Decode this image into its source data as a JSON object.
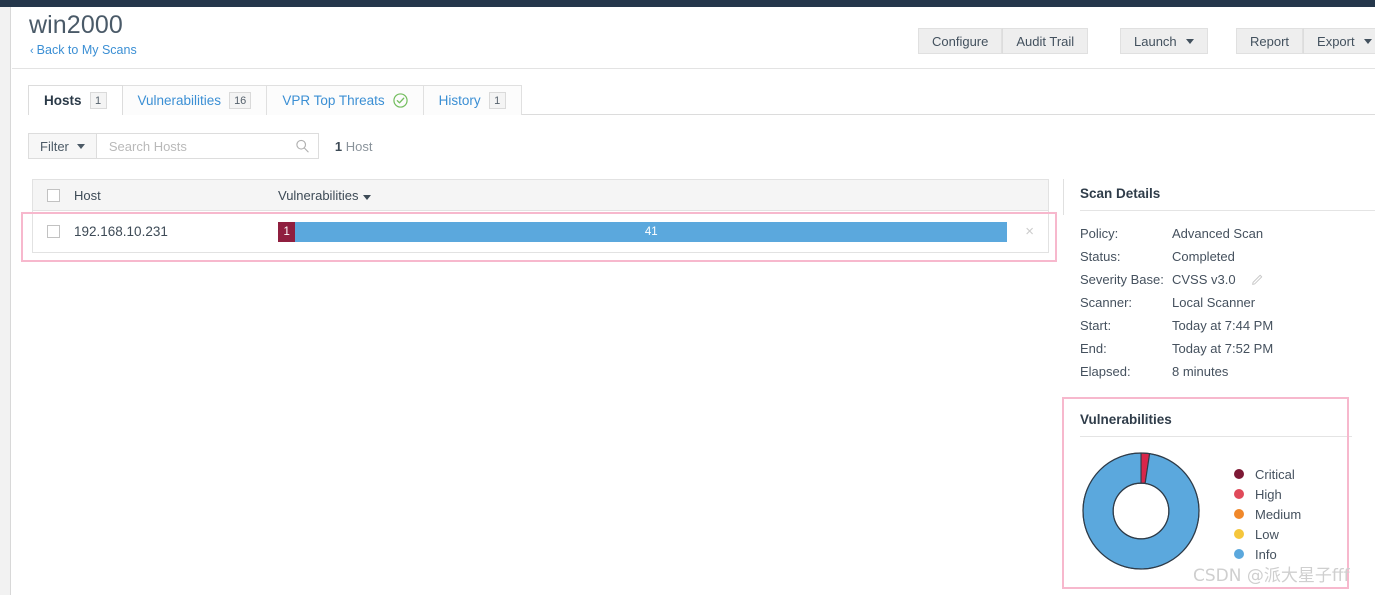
{
  "header": {
    "scan_title": "win2000",
    "back_link": "Back to My Scans",
    "back_chevron": "‹",
    "buttons_group_a": [
      {
        "label": "Configure",
        "caret": false
      },
      {
        "label": "Audit Trail",
        "caret": false
      }
    ],
    "buttons_group_b": [
      {
        "label": "Launch",
        "caret": true
      }
    ],
    "buttons_group_c": [
      {
        "label": "Report",
        "caret": false
      },
      {
        "label": "Export",
        "caret": true
      }
    ]
  },
  "tabs": [
    {
      "label": "Hosts",
      "badge": "1",
      "active": true,
      "icon": ""
    },
    {
      "label": "Vulnerabilities",
      "badge": "16",
      "active": false,
      "icon": ""
    },
    {
      "label": "VPR Top Threats",
      "badge": "",
      "active": false,
      "icon": "check-circle-icon"
    },
    {
      "label": "History",
      "badge": "1",
      "active": false,
      "icon": ""
    }
  ],
  "filter_bar": {
    "filter_label": "Filter",
    "search_placeholder": "Search Hosts",
    "search_value": "",
    "search_icon": "search-icon",
    "count_number": "1",
    "count_label": "Host"
  },
  "hosts_table": {
    "columns": [
      "Host",
      "Vulnerabilities"
    ],
    "sort_column": "Vulnerabilities",
    "sort_direction": "desc",
    "rows": [
      {
        "host": "192.168.10.231",
        "remove_icon": "×",
        "segments": [
          {
            "severity": "Critical",
            "count": "1",
            "color": "#8f1f3f",
            "width_pct": 2.4
          },
          {
            "severity": "Info",
            "count": "41",
            "color": "#5ba8dd",
            "width_pct": 97.6
          }
        ]
      }
    ]
  },
  "scan_details": {
    "title": "Scan Details",
    "edit_icon": "pencil-icon",
    "rows": [
      {
        "label": "Policy:",
        "value": "Advanced Scan",
        "edit": false
      },
      {
        "label": "Status:",
        "value": "Completed",
        "edit": false
      },
      {
        "label": "Severity Base:",
        "value": "CVSS v3.0",
        "edit": true
      },
      {
        "label": "Scanner:",
        "value": "Local Scanner",
        "edit": false
      },
      {
        "label": "Start:",
        "value": "Today at 7:44 PM",
        "edit": false
      },
      {
        "label": "End:",
        "value": "Today at 7:52 PM",
        "edit": false
      },
      {
        "label": "Elapsed:",
        "value": "8 minutes",
        "edit": false
      }
    ]
  },
  "vulnerabilities_panel": {
    "title": "Vulnerabilities",
    "legend": [
      {
        "label": "Critical",
        "color": "#7d1935"
      },
      {
        "label": "High",
        "color": "#e04a5a"
      },
      {
        "label": "Medium",
        "color": "#f0882a"
      },
      {
        "label": "Low",
        "color": "#f5c63c"
      },
      {
        "label": "Info",
        "color": "#5ba8dd"
      }
    ]
  },
  "chart_data": {
    "type": "pie",
    "title": "Vulnerabilities",
    "variant": "donut",
    "categories": [
      "Critical",
      "High",
      "Medium",
      "Low",
      "Info"
    ],
    "values": [
      1,
      0,
      0,
      0,
      41
    ],
    "colors": [
      "#7d1935",
      "#e04a5a",
      "#f0882a",
      "#f5c63c",
      "#5ba8dd"
    ],
    "total": 42,
    "legend_position": "right",
    "start_angle_deg": 0,
    "inner_radius_ratio": 0.48,
    "stroke_color": "#2f3c49",
    "slice_render_color_critical": "#d8264a"
  },
  "watermark": "CSDN @派大星子fff"
}
